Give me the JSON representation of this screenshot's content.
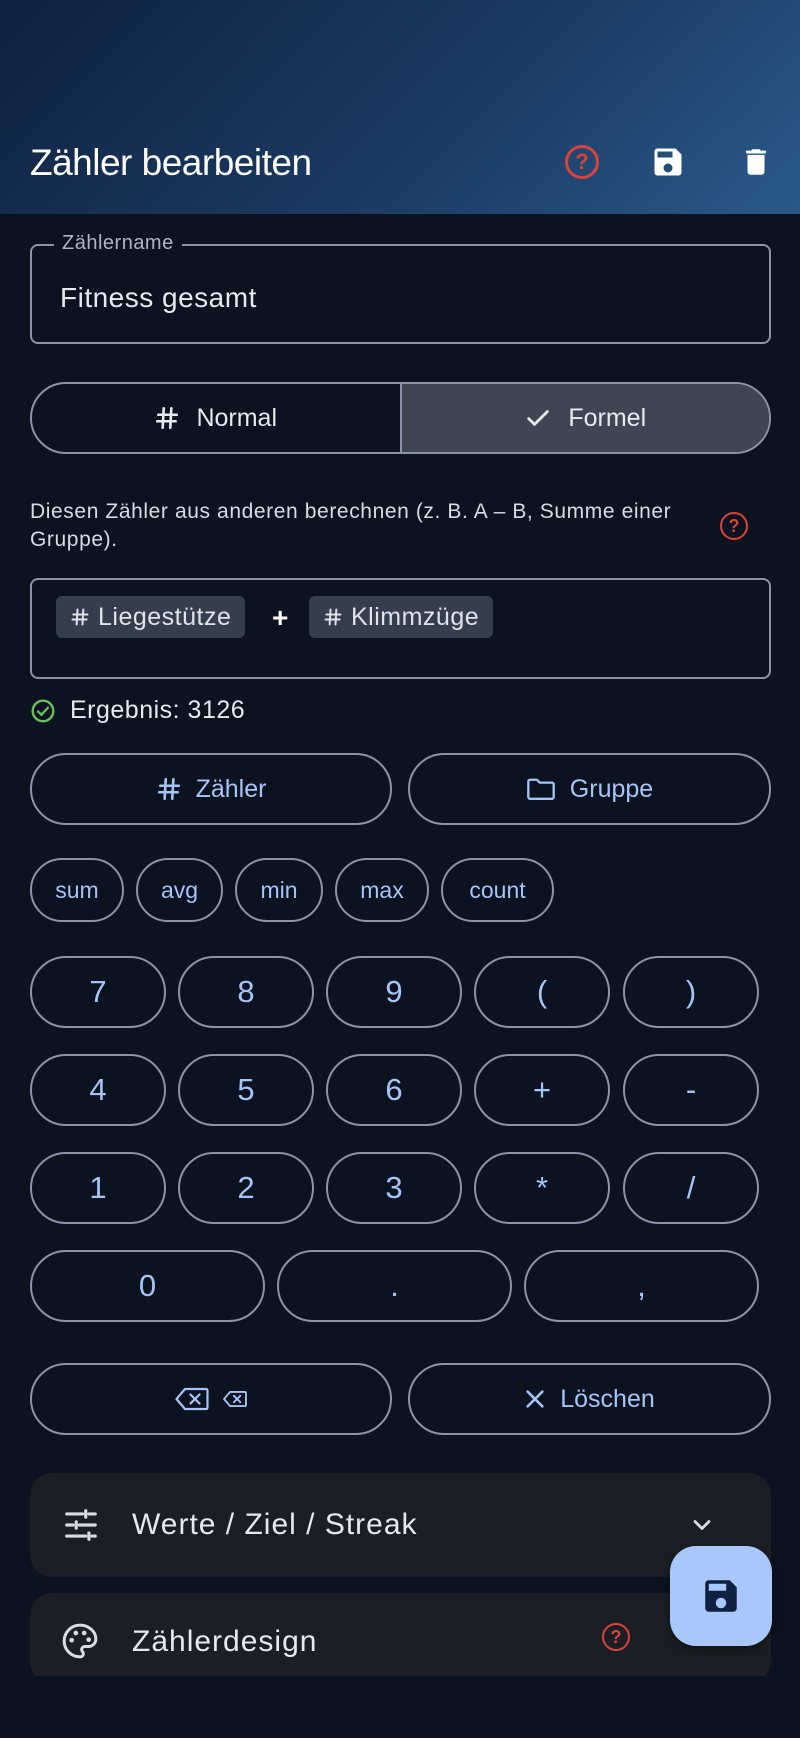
{
  "appbar": {
    "title": "Zähler bearbeiten"
  },
  "name_field": {
    "label": "Zählername",
    "value": "Fitness gesamt"
  },
  "mode": {
    "normal": "Normal",
    "formula": "Formel",
    "selected": "Formel"
  },
  "description": "Diesen Zähler aus anderen berechnen (z. B. A – B, Summe einer Gruppe).",
  "formula": {
    "token1": "Liegestütze",
    "operator": "+",
    "token2": "Klimmzüge"
  },
  "result": "Ergebnis: 3126",
  "insert": {
    "counter": "Zähler",
    "group": "Gruppe"
  },
  "functions": [
    "sum",
    "avg",
    "min",
    "max",
    "count"
  ],
  "keys": [
    "7",
    "8",
    "9",
    "(",
    ")",
    "4",
    "5",
    "6",
    "+",
    "-",
    "1",
    "2",
    "3",
    "*",
    "/",
    "0",
    ".",
    ","
  ],
  "actions": {
    "clear": "Löschen"
  },
  "panels": {
    "values": "Werte / Ziel / Streak",
    "design": "Zählerdesign"
  },
  "colors": {
    "accent": "#a7c4f7",
    "danger": "#d9443a",
    "success": "#6bbf5b",
    "fab": "#a9c7fb"
  }
}
